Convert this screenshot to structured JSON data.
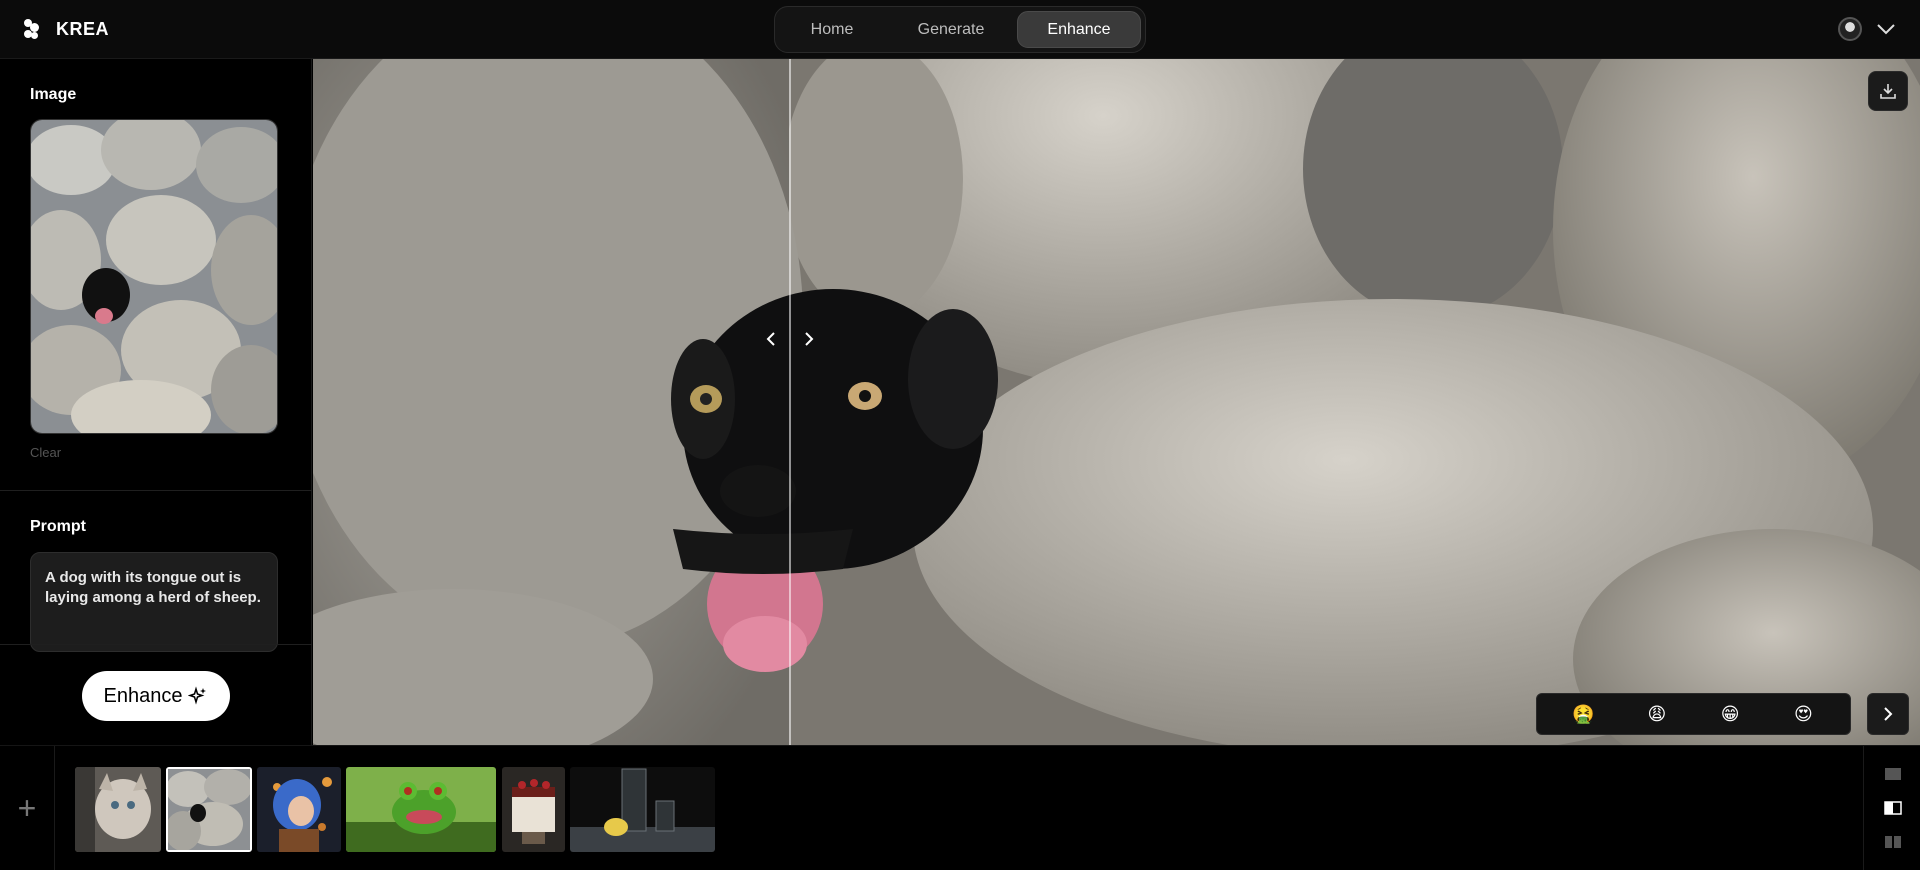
{
  "app": {
    "brand_name": "KREA",
    "brand_icon": "krea-logo-icon"
  },
  "nav": {
    "tabs": [
      {
        "label": "Home",
        "active": false
      },
      {
        "label": "Generate",
        "active": false
      },
      {
        "label": "Enhance",
        "active": true
      }
    ]
  },
  "user": {
    "avatar_icon": "avatar-icon",
    "menu_icon": "chevron-down-icon"
  },
  "left_panel": {
    "image_label": "Image",
    "clear_label": "Clear",
    "prompt_label": "Prompt",
    "prompt_text": "A dog with its tongue out is laying among a herd of sheep.",
    "enhance_button": "Enhance",
    "enhance_icon": "sparkles-icon"
  },
  "viewer": {
    "compare_left_icon": "chevron-left-icon",
    "compare_right_icon": "chevron-right-icon",
    "download_icon": "download-icon",
    "ratings": [
      {
        "emoji": "🤮",
        "name": "vomit-emoji-icon"
      },
      {
        "emoji": "😩",
        "name": "weary-emoji-icon"
      },
      {
        "emoji": "😁",
        "name": "grin-emoji-icon"
      },
      {
        "emoji": "😍",
        "name": "heart-eyes-emoji-icon"
      }
    ],
    "next_icon": "chevron-right-icon"
  },
  "bottom": {
    "add_label": "+",
    "thumbnails": [
      {
        "name": "thumb-kitten",
        "selected": false
      },
      {
        "name": "thumb-dog-sheep",
        "selected": true
      },
      {
        "name": "thumb-anime-girl",
        "selected": false
      },
      {
        "name": "thumb-frog",
        "selected": false
      },
      {
        "name": "thumb-cake",
        "selected": false
      },
      {
        "name": "thumb-glass-lemon",
        "selected": false
      }
    ],
    "view_modes": [
      "single-view-icon",
      "split-compare-icon",
      "side-by-side-icon"
    ]
  },
  "colors": {
    "background": "#000000",
    "panel": "#0b0b0b",
    "accent": "#ffffff",
    "fur": "#9a958c"
  }
}
